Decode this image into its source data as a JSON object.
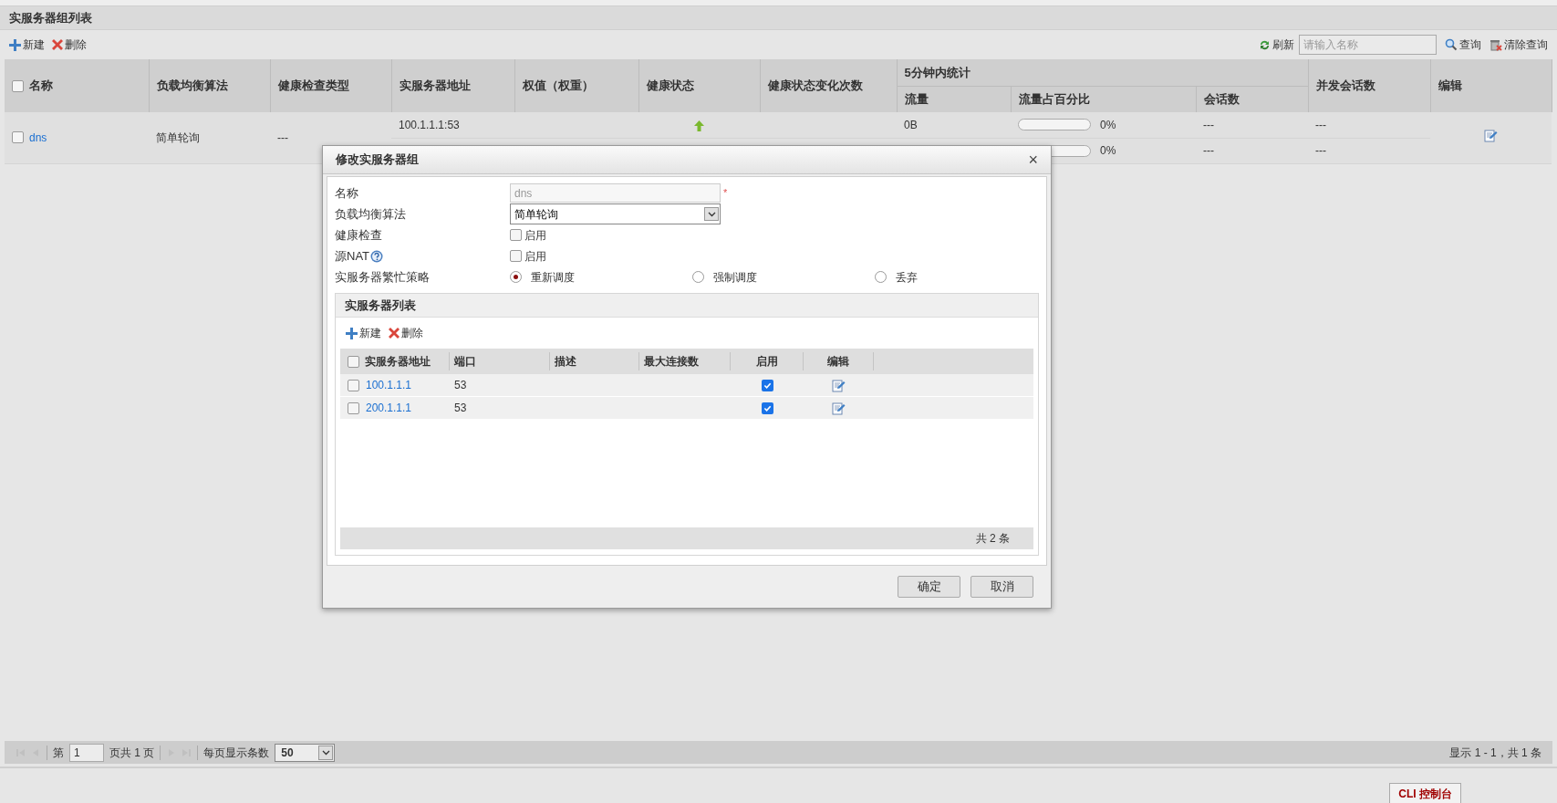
{
  "page": {
    "title": "实服务器组列表"
  },
  "toolbar": {
    "left": [
      {
        "kind": "add",
        "label": "新建"
      },
      {
        "kind": "delete",
        "label": "删除"
      }
    ],
    "refresh": "刷新",
    "search": {
      "placeholder": "请输入名称"
    },
    "query": "查询",
    "clear": "清除查询"
  },
  "table": {
    "select_all": {
      "checked": false
    },
    "columns": [
      {
        "label": "名称"
      },
      {
        "label": "负载均衡算法"
      },
      {
        "label": "健康检查类型"
      },
      {
        "label": "实服务器地址"
      },
      {
        "label": "权值（权重）"
      },
      {
        "label": "健康状态"
      },
      {
        "label": "健康状态变化次数"
      },
      {
        "label": "5分钟内统计",
        "children": [
          {
            "label": "流量"
          },
          {
            "label": "流量占百分比"
          },
          {
            "label": "会话数"
          }
        ]
      },
      {
        "label": "并发会话数"
      },
      {
        "label": "编辑"
      }
    ],
    "rows": [
      {
        "checked": false,
        "name": "dns",
        "algorithm": "简单轮询",
        "health_check_type": "---",
        "servers": [
          {
            "address": "100.1.1.1:53",
            "status_up": true,
            "traffic": "0B",
            "level": 0,
            "percent": "0%",
            "sessions": "---",
            "concurrent": "---"
          },
          {
            "level": 0,
            "percent": "0%",
            "sessions": "---",
            "concurrent": "---"
          }
        ]
      }
    ]
  },
  "pagination": {
    "nav": [
      {
        "kind": "first",
        "disabled": true
      },
      {
        "kind": "prev",
        "disabled": true
      },
      {
        "kind": "next",
        "disabled": true
      },
      {
        "kind": "last",
        "disabled": true
      }
    ],
    "page_prefix": "第",
    "page": "1",
    "page_suffix": "页共 1 页",
    "page_size_label": "每页显示条数",
    "page_size": "50",
    "summary": "显示 1 - 1，共 1 条"
  },
  "cli_tab": "CLI 控制台",
  "dialog": {
    "title": "修改实服务器组",
    "close": "×",
    "fields": [
      {
        "kind": "text",
        "label": "名称",
        "value": "dns",
        "disabled": true,
        "required": "*"
      },
      {
        "kind": "select",
        "label": "负载均衡算法",
        "value": "简单轮询"
      },
      {
        "kind": "checkbox",
        "label": "健康检查",
        "option": "启用",
        "checked": false
      },
      {
        "kind": "checkbox",
        "label": "源NAT",
        "help": true,
        "option": "启用",
        "checked": false
      },
      {
        "kind": "radio",
        "label": "实服务器繁忙策略",
        "options": [
          {
            "label": "重新调度",
            "selected": true
          },
          {
            "label": "强制调度",
            "selected": false
          },
          {
            "label": "丢弃",
            "selected": false
          }
        ]
      }
    ],
    "panel": {
      "title": "实服务器列表",
      "toolbar": [
        {
          "kind": "add",
          "label": "新建"
        },
        {
          "kind": "delete",
          "label": "删除"
        }
      ],
      "select_all": {
        "checked": false
      },
      "columns": [
        "实服务器地址",
        "端口",
        "描述",
        "最大连接数",
        "启用",
        "编辑"
      ],
      "rows": [
        {
          "checked": false,
          "address": "100.1.1.1",
          "port": "53",
          "enabled": true
        },
        {
          "checked": false,
          "address": "200.1.1.1",
          "port": "53",
          "enabled": true
        }
      ],
      "footer": "共 2 条"
    },
    "buttons": [
      "确定",
      "取消"
    ]
  }
}
